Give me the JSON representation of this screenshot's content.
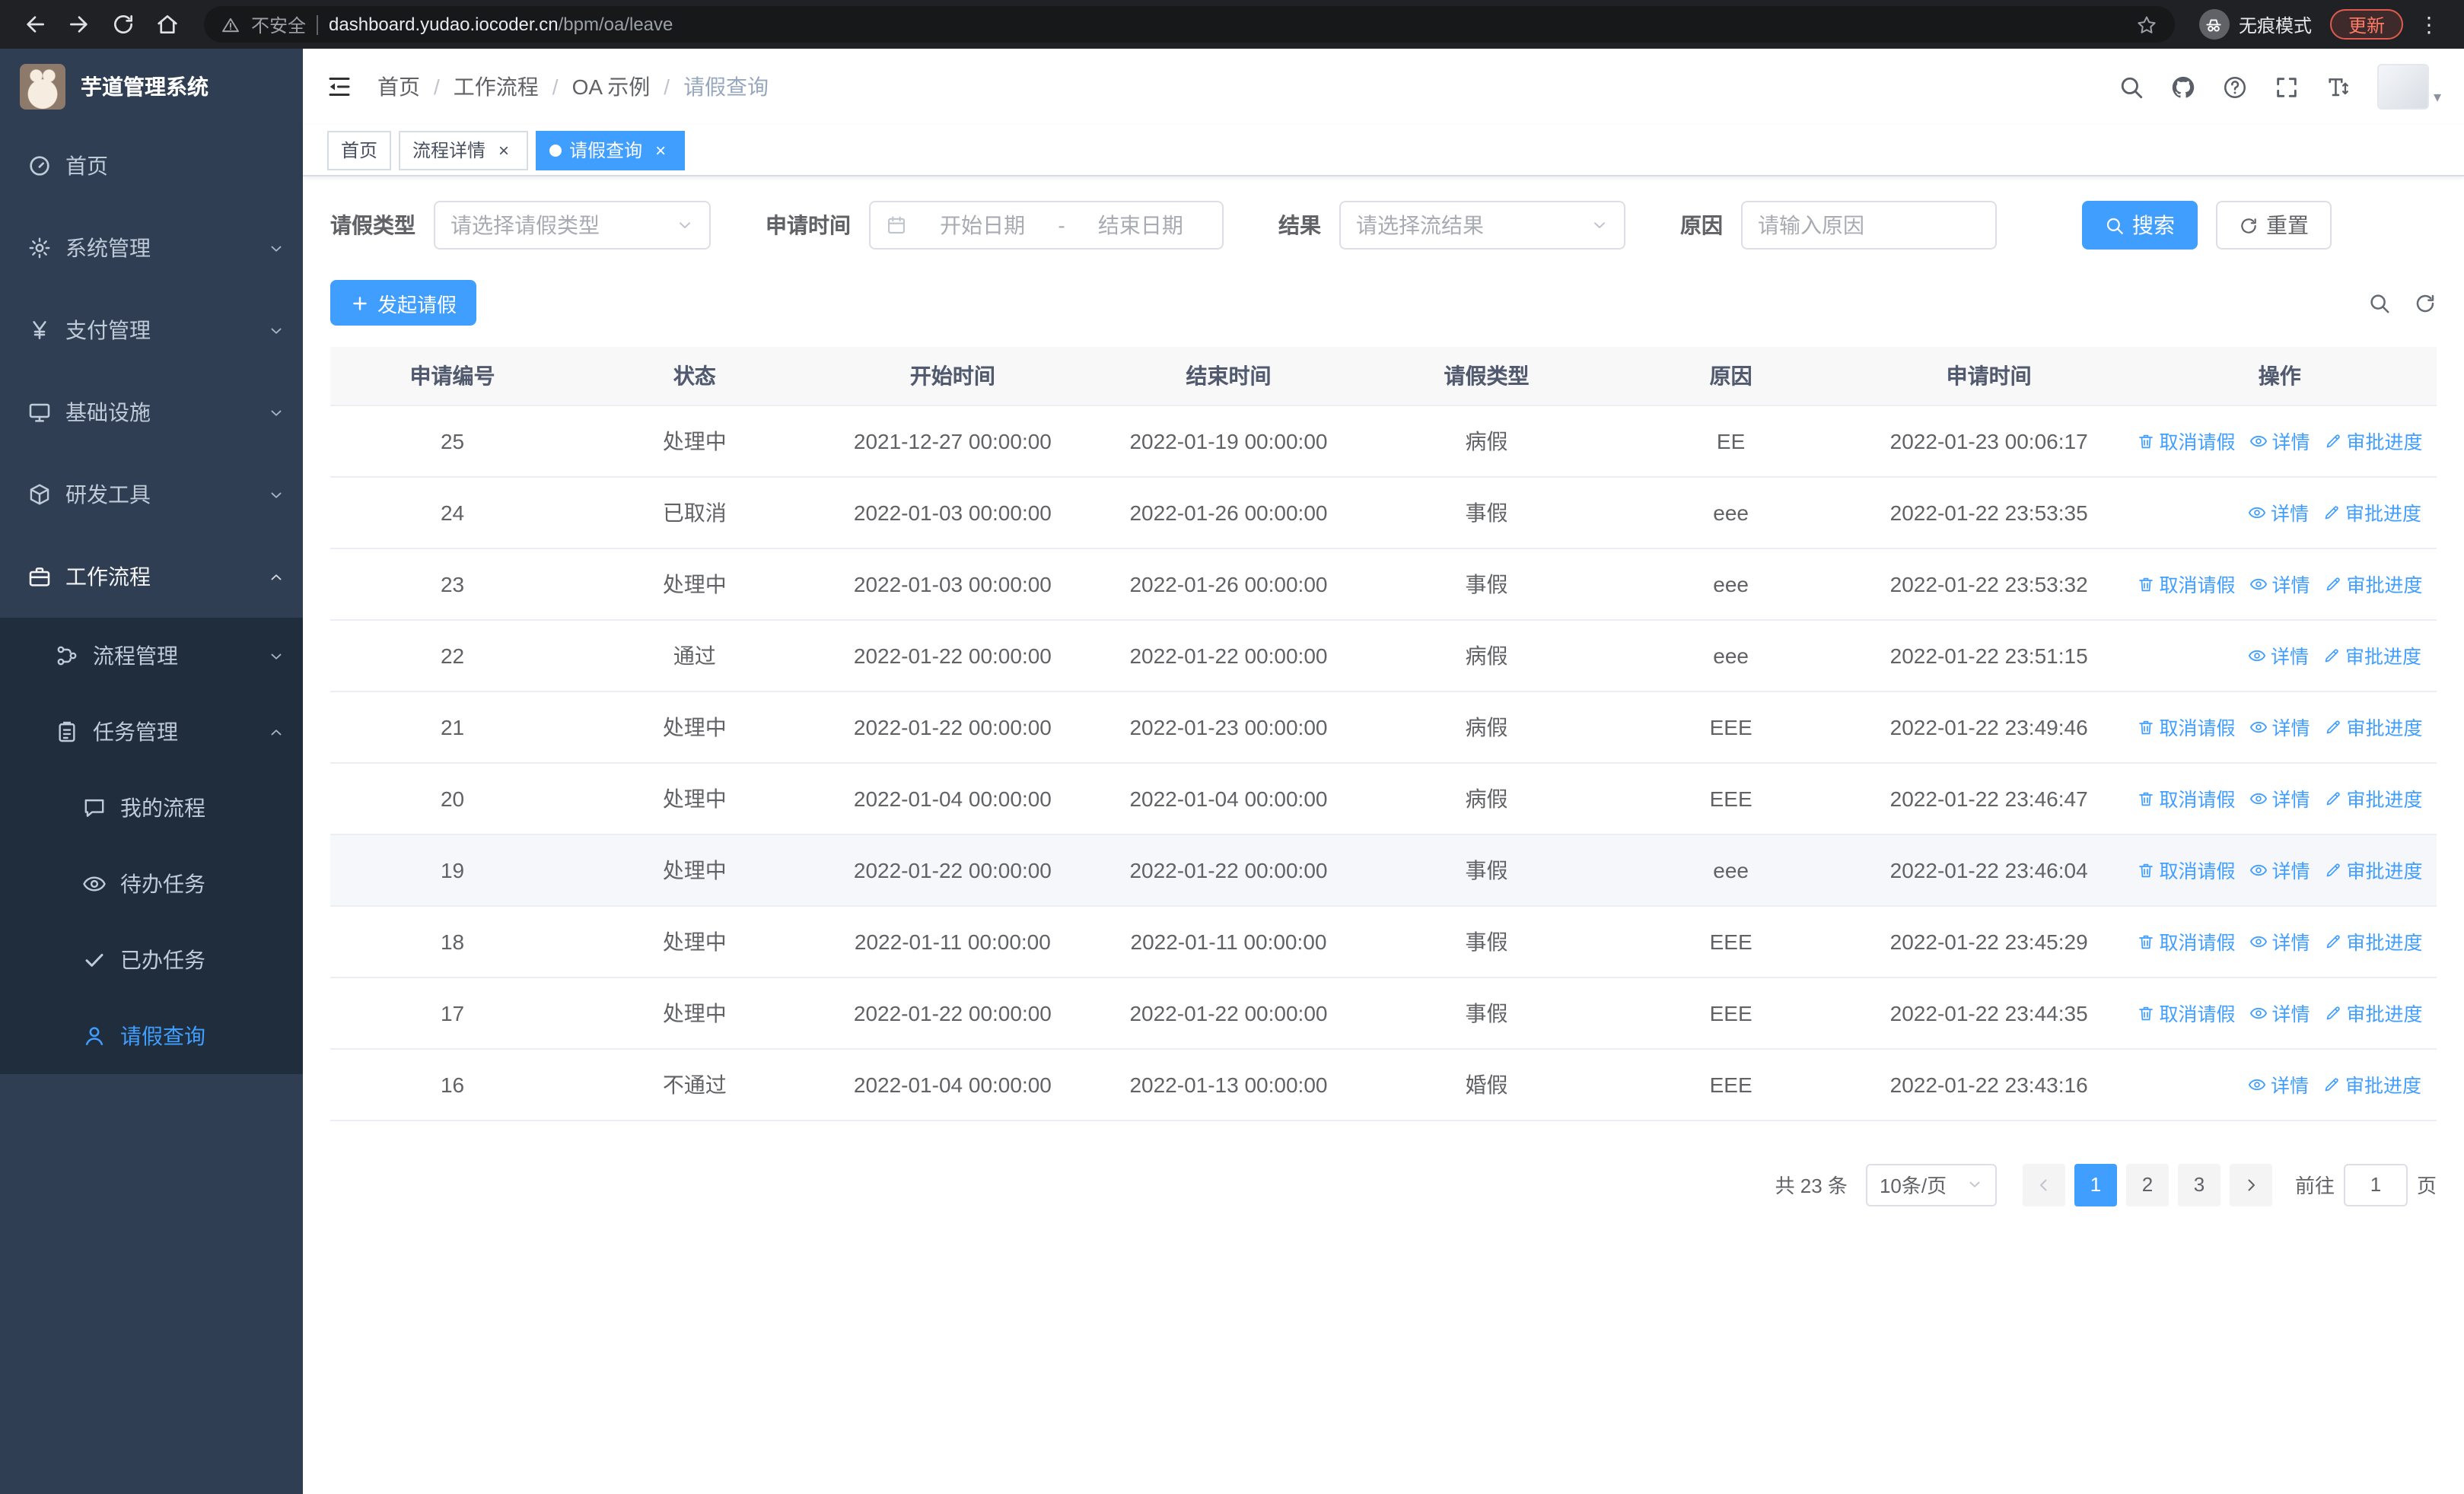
{
  "browser": {
    "not_secure_label": "不安全",
    "url_domain": "dashboard.yudao.iocoder.cn",
    "url_path": "/bpm/oa/leave",
    "incognito_label": "无痕模式",
    "update_label": "更新"
  },
  "glyphs": {
    "close": "×",
    "breadcrumb_separator": "/",
    "range_separator": "-",
    "kebab": "⋮",
    "caret": "▾"
  },
  "icons": {
    "search": "magnifier",
    "refresh": "circular-arrow",
    "calendar": "calendar-grid",
    "eye": "eye-outline",
    "trash": "trash-bin",
    "pencil": "pencil",
    "plus": "plus",
    "github": "octocat-silhouette",
    "question": "question-circle",
    "fullscreen": "corner-brackets",
    "font-size": "letter-T-with-arrows",
    "hamburger": "menu-fold",
    "star": "star-outline",
    "warning": "warning-triangle",
    "incognito": "spy-glasses",
    "chevron-down": "⌄",
    "chevron-up": "⌃",
    "chevron-left": "‹",
    "chevron-right": "›"
  },
  "sidebar": {
    "title": "芋道管理系统",
    "items": [
      {
        "label": "首页",
        "icon": "dashboard-icon"
      },
      {
        "label": "系统管理",
        "icon": "gear-icon"
      },
      {
        "label": "支付管理",
        "icon": "payment-icon"
      },
      {
        "label": "基础设施",
        "icon": "infrastructure-icon"
      },
      {
        "label": "研发工具",
        "icon": "devtools-icon"
      },
      {
        "label": "工作流程",
        "icon": "workflow-icon",
        "expanded": true,
        "children": [
          {
            "label": "流程管理",
            "icon": "process-icon"
          },
          {
            "label": "任务管理",
            "icon": "task-icon",
            "expanded": true,
            "children": [
              {
                "label": "我的流程",
                "icon": "my-process-icon"
              },
              {
                "label": "待办任务",
                "icon": "todo-icon"
              },
              {
                "label": "已办任务",
                "icon": "done-icon"
              },
              {
                "label": "请假查询",
                "icon": "leave-query-icon",
                "active": true
              }
            ]
          }
        ]
      }
    ]
  },
  "header": {
    "breadcrumb": [
      "首页",
      "工作流程",
      "OA 示例",
      "请假查询"
    ]
  },
  "tabs": [
    {
      "label": "首页",
      "active": false,
      "closable": false
    },
    {
      "label": "流程详情",
      "active": false,
      "closable": true
    },
    {
      "label": "请假查询",
      "active": true,
      "closable": true
    }
  ],
  "filters": {
    "leave_type_label": "请假类型",
    "leave_type_placeholder": "请选择请假类型",
    "apply_time_label": "申请时间",
    "start_placeholder": "开始日期",
    "end_placeholder": "结束日期",
    "result_label": "结果",
    "result_placeholder": "请选择流结果",
    "reason_label": "原因",
    "reason_placeholder": "请输入原因",
    "search_label": "搜索",
    "reset_label": "重置"
  },
  "toolbar": {
    "create_label": "发起请假"
  },
  "table": {
    "columns": [
      "申请编号",
      "状态",
      "开始时间",
      "结束时间",
      "请假类型",
      "原因",
      "申请时间",
      "操作"
    ],
    "action_labels": {
      "cancel": "取消请假",
      "detail": "详情",
      "progress": "审批进度"
    },
    "rows": [
      {
        "no": "25",
        "status": "处理中",
        "start": "2021-12-27 00:00:00",
        "end": "2022-01-19 00:00:00",
        "type": "病假",
        "reason": "EE",
        "applied": "2022-01-23 00:06:17",
        "cancel": true,
        "highlight": false
      },
      {
        "no": "24",
        "status": "已取消",
        "start": "2022-01-03 00:00:00",
        "end": "2022-01-26 00:00:00",
        "type": "事假",
        "reason": "eee",
        "applied": "2022-01-22 23:53:35",
        "cancel": false,
        "highlight": false
      },
      {
        "no": "23",
        "status": "处理中",
        "start": "2022-01-03 00:00:00",
        "end": "2022-01-26 00:00:00",
        "type": "事假",
        "reason": "eee",
        "applied": "2022-01-22 23:53:32",
        "cancel": true,
        "highlight": false
      },
      {
        "no": "22",
        "status": "通过",
        "start": "2022-01-22 00:00:00",
        "end": "2022-01-22 00:00:00",
        "type": "病假",
        "reason": "eee",
        "applied": "2022-01-22 23:51:15",
        "cancel": false,
        "highlight": false
      },
      {
        "no": "21",
        "status": "处理中",
        "start": "2022-01-22 00:00:00",
        "end": "2022-01-23 00:00:00",
        "type": "病假",
        "reason": "EEE",
        "applied": "2022-01-22 23:49:46",
        "cancel": true,
        "highlight": false
      },
      {
        "no": "20",
        "status": "处理中",
        "start": "2022-01-04 00:00:00",
        "end": "2022-01-04 00:00:00",
        "type": "病假",
        "reason": "EEE",
        "applied": "2022-01-22 23:46:47",
        "cancel": true,
        "highlight": false
      },
      {
        "no": "19",
        "status": "处理中",
        "start": "2022-01-22 00:00:00",
        "end": "2022-01-22 00:00:00",
        "type": "事假",
        "reason": "eee",
        "applied": "2022-01-22 23:46:04",
        "cancel": true,
        "highlight": true
      },
      {
        "no": "18",
        "status": "处理中",
        "start": "2022-01-11 00:00:00",
        "end": "2022-01-11 00:00:00",
        "type": "事假",
        "reason": "EEE",
        "applied": "2022-01-22 23:45:29",
        "cancel": true,
        "highlight": false
      },
      {
        "no": "17",
        "status": "处理中",
        "start": "2022-01-22 00:00:00",
        "end": "2022-01-22 00:00:00",
        "type": "事假",
        "reason": "EEE",
        "applied": "2022-01-22 23:44:35",
        "cancel": true,
        "highlight": false
      },
      {
        "no": "16",
        "status": "不通过",
        "start": "2022-01-04 00:00:00",
        "end": "2022-01-13 00:00:00",
        "type": "婚假",
        "reason": "EEE",
        "applied": "2022-01-22 23:43:16",
        "cancel": false,
        "highlight": false
      }
    ]
  },
  "pagination": {
    "total": "共 23 条",
    "page_size": "10条/页",
    "pages": [
      "1",
      "2",
      "3"
    ],
    "active_page": "1",
    "goto_label": "前往",
    "goto_value": "1",
    "page_unit": "页"
  },
  "colors": {
    "accent": "#409eff",
    "sidebar_bg": "#2f3e52",
    "sidebar_sub_bg": "#1f2d3d",
    "chrome_bg": "#202124"
  }
}
